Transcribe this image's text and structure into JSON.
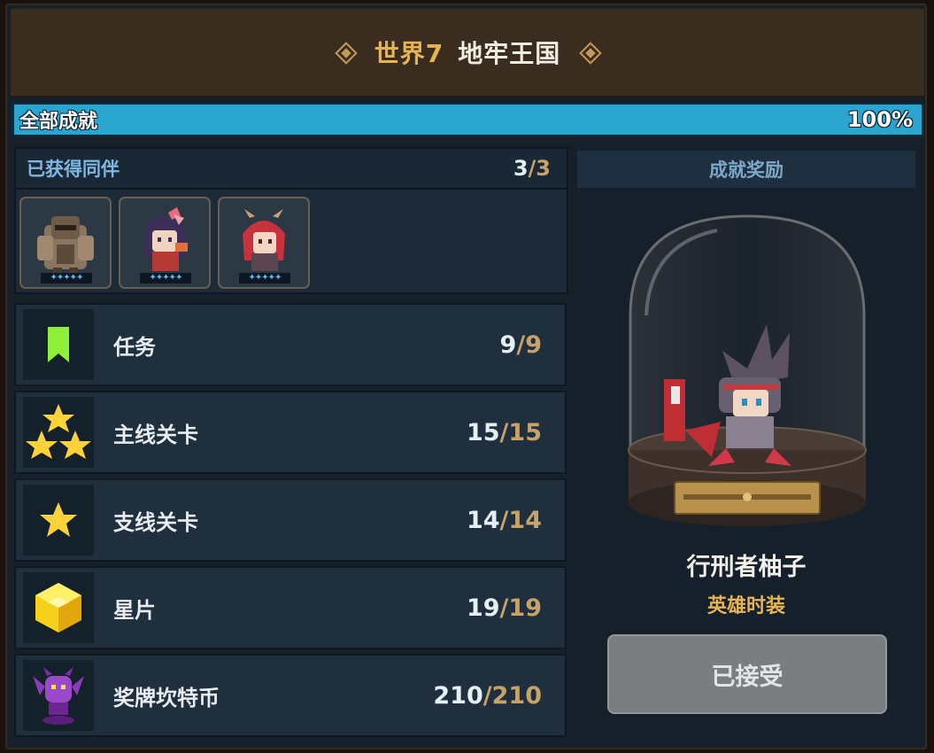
{
  "header": {
    "world": "世界7",
    "name": "地牢王国"
  },
  "progress": {
    "label": "全部成就",
    "percent_text": "100%",
    "fill_fraction": 1.0
  },
  "companions": {
    "title": "已获得同伴",
    "count_current": "3",
    "count_total": "3",
    "avatars": [
      {
        "icon": "armored-knight-companion",
        "stars": "4-star"
      },
      {
        "icon": "ribbon-girl-companion",
        "stars": "4-star"
      },
      {
        "icon": "horned-redhead-companion",
        "stars": "4-star"
      }
    ]
  },
  "achievements": [
    {
      "label": "任务",
      "current": "9",
      "total": "9",
      "icon": "bookmark-icon"
    },
    {
      "label": "主线关卡",
      "current": "15",
      "total": "15",
      "icon": "three-stars-icon"
    },
    {
      "label": "支线关卡",
      "current": "14",
      "total": "14",
      "icon": "star-icon"
    },
    {
      "label": "星片",
      "current": "19",
      "total": "19",
      "icon": "gold-cube-icon"
    },
    {
      "label": "奖牌坎特币",
      "current": "210",
      "total": "210",
      "icon": "purple-gargoyle-icon"
    }
  ],
  "reward": {
    "title": "成就奖励",
    "character_name": "行刑者柚子",
    "character_type": "英雄时装",
    "button_label": "已接受"
  },
  "colors": {
    "gold": "#e6b457",
    "progress_bar": "#2aa5cf",
    "panel": "#1f2f3d",
    "button_disabled": "#7b7e80"
  }
}
